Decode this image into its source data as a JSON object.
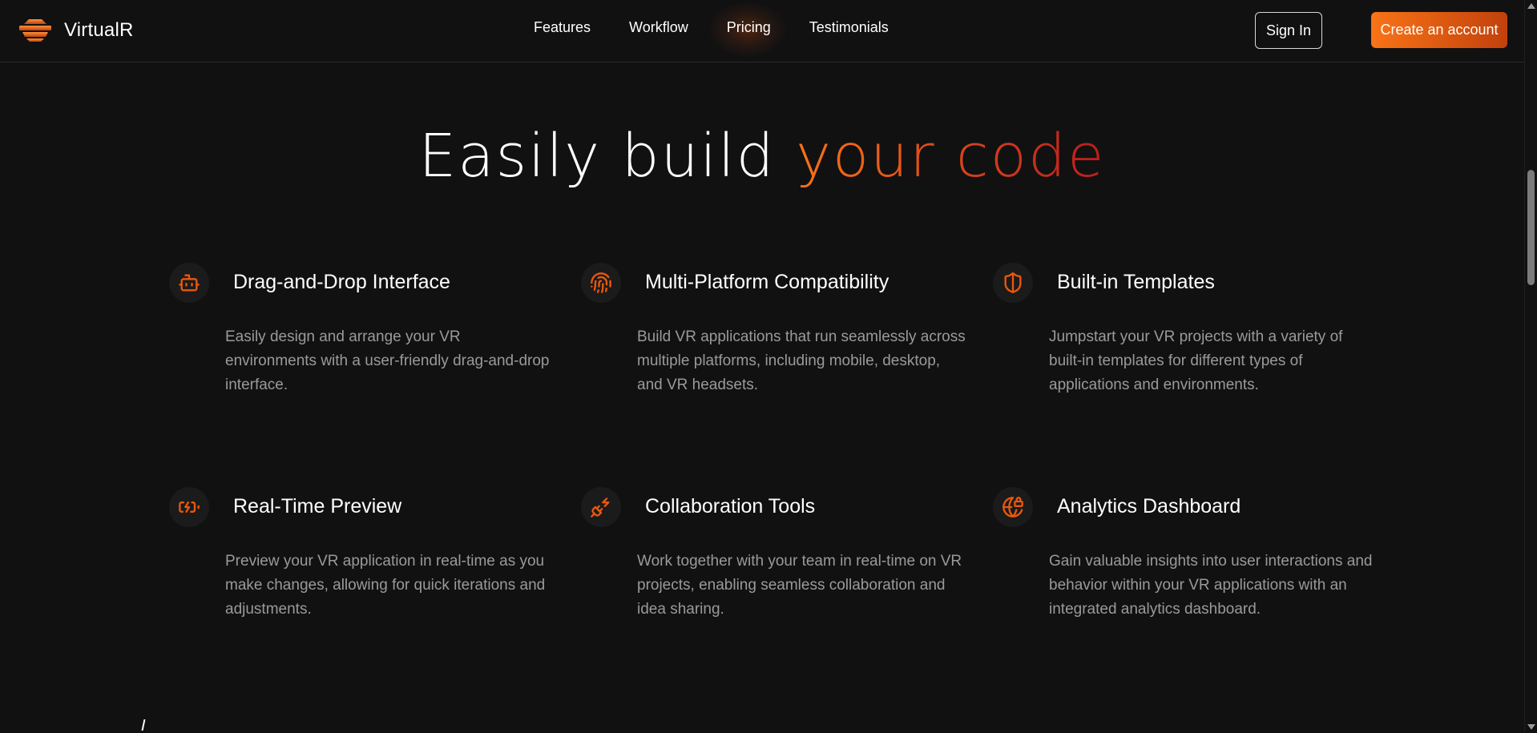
{
  "brand": {
    "name": "VirtualR",
    "accent_start": "#f97316",
    "accent_end": "#b91c1c"
  },
  "nav": {
    "links": [
      {
        "label": "Features"
      },
      {
        "label": "Workflow"
      },
      {
        "label": "Pricing"
      },
      {
        "label": "Testimonials"
      }
    ],
    "sign_in": "Sign In",
    "create_account": "Create an account"
  },
  "hero": {
    "headline_plain": "Easily build",
    "headline_accent": "your code"
  },
  "features": [
    {
      "icon": "bot-icon",
      "title": "Drag-and-Drop Interface",
      "description": "Easily design and arrange your VR environments with a user-friendly drag-and-drop interface."
    },
    {
      "icon": "fingerprint-icon",
      "title": "Multi-Platform Compatibility",
      "description": "Build VR applications that run seamlessly across multiple platforms, including mobile, desktop, and VR headsets."
    },
    {
      "icon": "shield-half-icon",
      "title": "Built-in Templates",
      "description": "Jumpstart your VR projects with a variety of built-in templates for different types of applications and environments."
    },
    {
      "icon": "battery-charging-icon",
      "title": "Real-Time Preview",
      "description": "Preview your VR application in real-time as you make changes, allowing for quick iterations and adjustments."
    },
    {
      "icon": "plug-zap-icon",
      "title": "Collaboration Tools",
      "description": "Work together with your team in real-time on VR projects, enabling seamless collaboration and idea sharing."
    },
    {
      "icon": "globe-lock-icon",
      "title": "Analytics Dashboard",
      "description": "Gain valuable insights into user interactions and behavior within your VR applications with an integrated analytics dashboard."
    }
  ]
}
